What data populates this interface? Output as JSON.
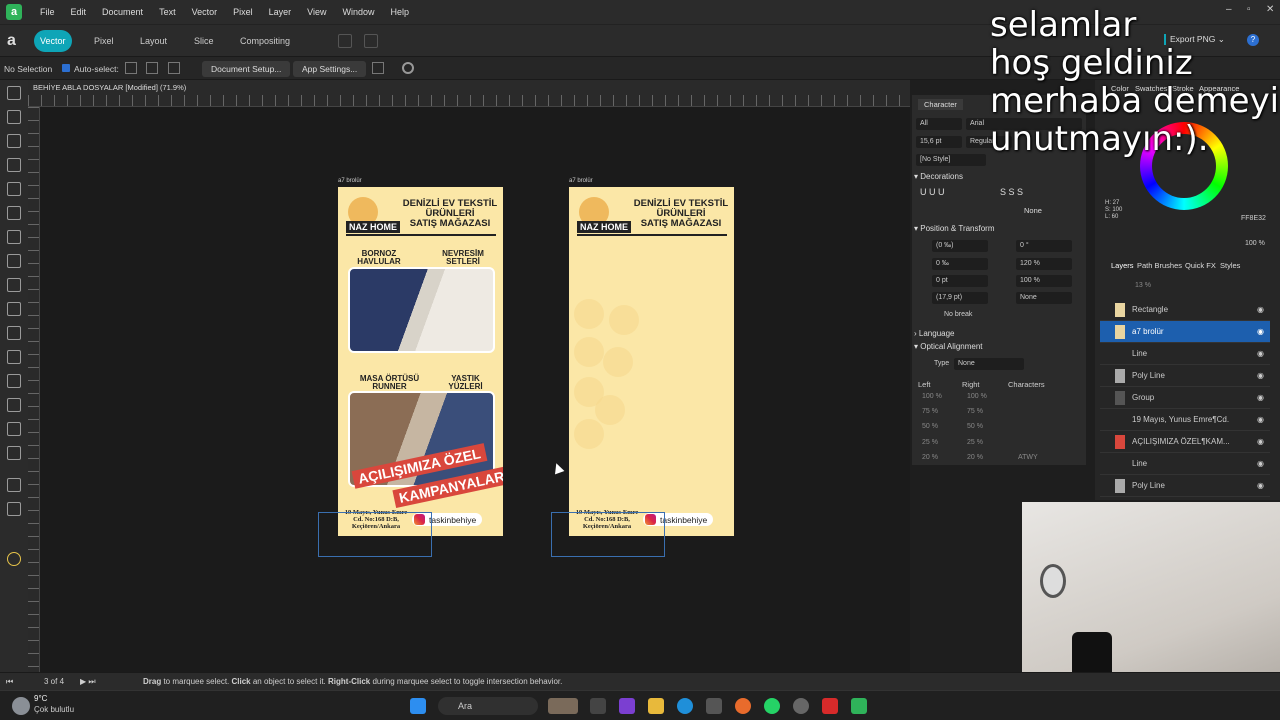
{
  "menubar": {
    "items": [
      "File",
      "Edit",
      "Document",
      "Text",
      "Vector",
      "Pixel",
      "Layer",
      "View",
      "Window",
      "Help"
    ]
  },
  "toolbar": {
    "personas": [
      "Vector",
      "Pixel",
      "Layout",
      "Slice",
      "Compositing"
    ],
    "export_label": "Export PNG"
  },
  "context_bar": {
    "selection": "No Selection",
    "auto_select": "Auto-select:",
    "document_setup": "Document Setup...",
    "app_settings": "App Settings..."
  },
  "document": {
    "title": "BEHİYE ABLA DOSYALAR [Modified] (71.9%)"
  },
  "artboards": [
    {
      "label": "a7 brolür",
      "headline": [
        "DENİZLİ EV TEKSTİL",
        "ÜRÜNLERİ",
        "SATIŞ MAĞAZASI"
      ],
      "brand": "NAZ HOME",
      "sections": [
        "BORNOZ HAVLULAR",
        "NEVRESİM SETLERİ",
        "MASA ÖRTÜSÜ RUNNER",
        "YASTIK YÜZLERİ"
      ],
      "promo": [
        "AÇILIŞIMIZA ÖZEL",
        "KAMPANYALAR"
      ],
      "address": [
        "19 Mayıs, Yunus Emre",
        "Cd. No:168 D:B,",
        "Keçiören/Ankara"
      ],
      "instagram": "taskinbehiye"
    },
    {
      "label": "a7 brolür",
      "headline": [
        "DENİZLİ EV TEKSTİL",
        "ÜRÜNLERİ",
        "SATIŞ MAĞAZASI"
      ],
      "brand": "NAZ HOME",
      "address": [
        "19 Mayıs, Yunus Emre",
        "Cd. No:168 D:B,",
        "Keçiören/Ankara"
      ],
      "instagram": "taskinbehiye"
    }
  ],
  "character_panel": {
    "title": "Character",
    "scope": "All",
    "font": "Arial",
    "size": "15,6 pt",
    "weight": "Regular",
    "style": "[No Style]",
    "decorations": "Decorations",
    "none_label": "None",
    "position_transform": "Position & Transform",
    "fields": [
      "(0 ‰)",
      "0 °",
      "0 ‰",
      "120 %",
      "0 pt",
      "100 %",
      "(17,9 pt)",
      "None"
    ],
    "no_break": "No break",
    "language": "Language",
    "optical_alignment": "Optical Alignment",
    "type_label": "Type",
    "type_value": "None",
    "columns": [
      "Left",
      "Right",
      "Characters"
    ],
    "rows": [
      [
        "100 %",
        "100 %"
      ],
      [
        "75 %",
        "75 %"
      ],
      [
        "50 %",
        "50 %"
      ],
      [
        "25 %",
        "25 %"
      ],
      [
        "20 %",
        "20 %"
      ]
    ],
    "last_chars": "ATWY"
  },
  "color_panel": {
    "tabs": [
      "Color",
      "Swatches",
      "Stroke",
      "Appearance"
    ],
    "hex": "FF8E32",
    "hsl": [
      "H: 27",
      "S: 100",
      "L: 60"
    ],
    "opacity": "100 %"
  },
  "layers_panel": {
    "tabs": [
      "Layers",
      "Path Brushes",
      "Quick FX",
      "Styles"
    ],
    "opacity": "13 %",
    "rows": [
      "Rectangle",
      "a7 brolür",
      "Line",
      "Poly Line",
      "Group",
      "19 Mayıs, Yunus Emre¶Cd.",
      "AÇILIŞIMIZA ÖZEL¶KAM...",
      "Line",
      "Poly Line"
    ]
  },
  "statusbar": {
    "page": "3 of 4",
    "hint_bold1": "Drag",
    "hint1": " to marquee select. ",
    "hint_bold2": "Click",
    "hint2": " an object to select it. ",
    "hint_bold3": "Right-Click",
    "hint3": " during marquee select to toggle intersection behavior."
  },
  "taskbar": {
    "temperature": "9°C",
    "weather": "Çok bulutlu",
    "search": "Ara"
  },
  "overlay_text": [
    "selamlar",
    "hoş geldiniz",
    "merhaba demeyi",
    "unutmayın:)."
  ]
}
